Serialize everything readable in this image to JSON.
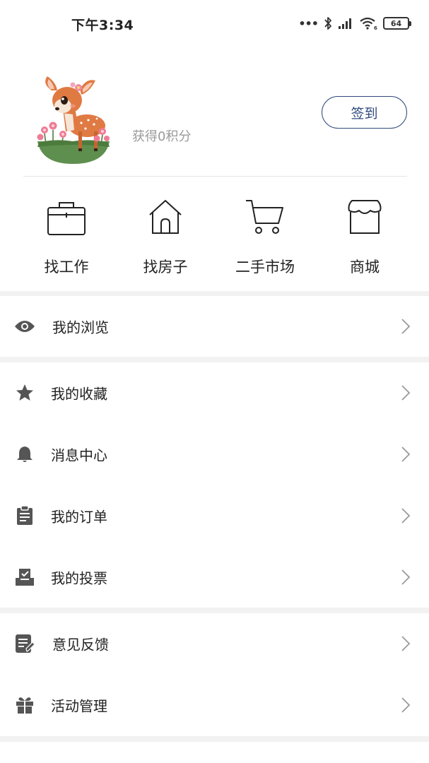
{
  "status_bar": {
    "time": "下午3:34",
    "dots": "•••",
    "battery": "64",
    "icons": [
      "bluetooth-icon",
      "signal-icon",
      "wifi-icon",
      "battery-icon"
    ]
  },
  "profile": {
    "avatar": "deer-avatar",
    "points_text": "获得0积分",
    "checkin_label": "签到"
  },
  "quick_actions": [
    {
      "label": "找工作",
      "icon": "briefcase-icon"
    },
    {
      "label": "找房子",
      "icon": "house-icon"
    },
    {
      "label": "二手市场",
      "icon": "cart-icon"
    },
    {
      "label": "商城",
      "icon": "shop-icon"
    }
  ],
  "menu": [
    {
      "label": "我的浏览",
      "icon": "eye-icon"
    },
    {
      "label": "我的收藏",
      "icon": "star-icon"
    },
    {
      "label": "消息中心",
      "icon": "bell-icon"
    },
    {
      "label": "我的订单",
      "icon": "clipboard-icon"
    },
    {
      "label": "我的投票",
      "icon": "ballot-icon"
    },
    {
      "label": "意见反馈",
      "icon": "feedback-icon"
    },
    {
      "label": "活动管理",
      "icon": "gift-icon"
    }
  ],
  "colors": {
    "accent": "#2f4a7c",
    "icon_gray": "#555555",
    "muted_text": "#9a9a9a",
    "band": "#f2f2f2"
  }
}
